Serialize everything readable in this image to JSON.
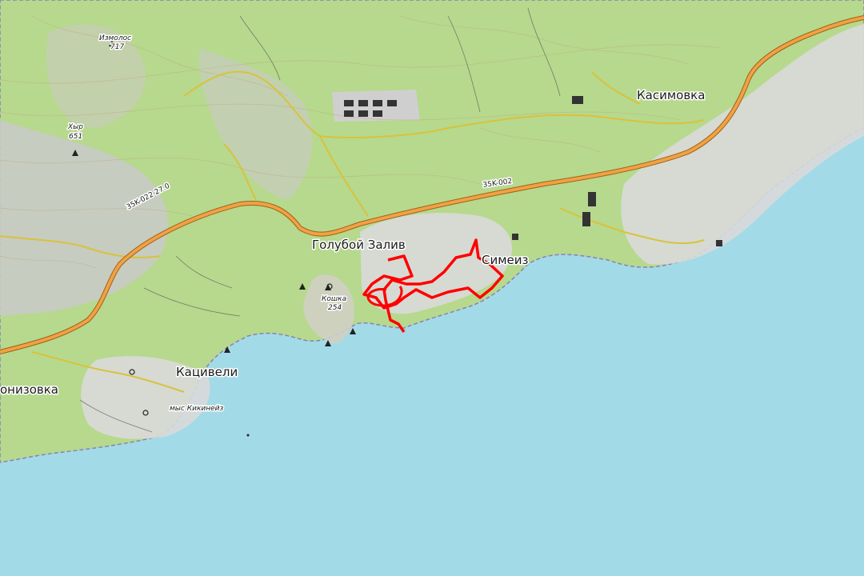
{
  "map": {
    "colors": {
      "sea": "#a2dbe7",
      "land_forest": "#b6d98d",
      "land_slope": "#c9c9c9",
      "built_up": "#d9d9d9",
      "highway": "#f0a244",
      "road": "#e8d84c",
      "coast_border": "#8c7fb8",
      "track": "#ff0000"
    },
    "towns": {
      "goluboy_zaliv": "Голубой Залив",
      "simeiz": "Симеиз",
      "katsiveli": "Кацивели",
      "kasimovka": "Касимовка",
      "ponizovka_partial": "онизовка"
    },
    "peaks": {
      "izmolos_name": "Измолос",
      "izmolos_elev": "717",
      "khyr_name": "Хыр",
      "khyr_elev": "651",
      "koshka_name": "Кошка",
      "koshka_elev": "254"
    },
    "capes": {
      "kikineiz": "мыс Кикинейз"
    },
    "roads": {
      "road_1": "35K-002",
      "road_2": "35K-022 27.0"
    },
    "icons": [
      "peak-icon",
      "cave-icon",
      "shelter-icon",
      "viewpoint-icon"
    ]
  }
}
